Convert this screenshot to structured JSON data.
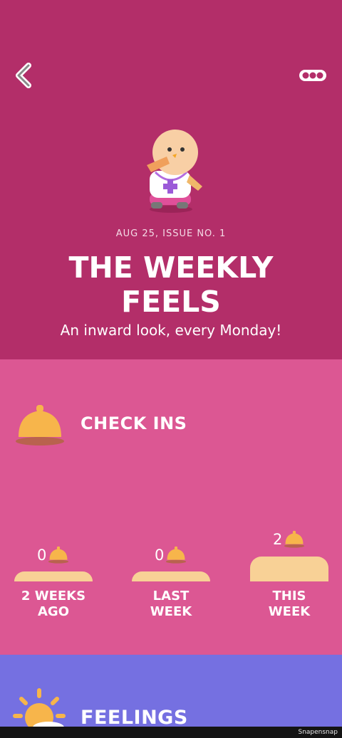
{
  "header": {
    "back_icon": "chevron-left-icon",
    "more_icon": "more-dots-icon"
  },
  "hero": {
    "issue_line": "AUG 25, ISSUE NO. 1",
    "title_line1": "THE WEEKLY",
    "title_line2": "FEELS",
    "subtitle": "An inward look, every Monday!"
  },
  "checkins": {
    "title": "CHECK INS",
    "icon": "bell-icon",
    "bars": [
      {
        "count": "0",
        "label_line1": "2 WEEKS",
        "label_line2": "AGO",
        "value": 0
      },
      {
        "count": "0",
        "label_line1": "LAST",
        "label_line2": "WEEK",
        "value": 0
      },
      {
        "count": "2",
        "label_line1": "THIS",
        "label_line2": "WEEK",
        "value": 2
      }
    ]
  },
  "feelings": {
    "title": "FEELINGS",
    "icon": "sun-cloud-icon"
  },
  "footer": {
    "watermark": "Snapensnap"
  },
  "colors": {
    "hero_bg": "#b32e69",
    "checkins_bg": "#dc5793",
    "feelings_bg": "#7570e1",
    "bar_color": "#f8d196",
    "bell_color": "#f7b54b"
  }
}
